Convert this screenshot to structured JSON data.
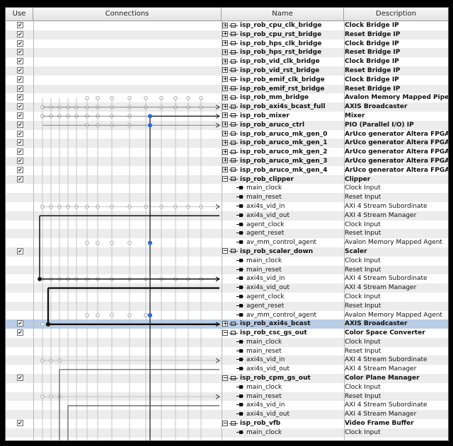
{
  "headers": {
    "use": "Use",
    "connections": "Connections",
    "name": "Name",
    "description": "Description"
  },
  "rows": [
    {
      "type": "module",
      "name": "isp_rob_cpu_clk_bridge",
      "desc": "Clock Bridge IP",
      "checked": true
    },
    {
      "type": "module",
      "name": "isp_rob_cpu_rst_bridge",
      "desc": "Reset Bridge IP",
      "checked": true
    },
    {
      "type": "module",
      "name": "isp_rob_hps_clk_bridge",
      "desc": "Clock Bridge IP",
      "checked": true
    },
    {
      "type": "module",
      "name": "isp_rob_hps_rst_bridge",
      "desc": "Reset Bridge IP",
      "checked": true
    },
    {
      "type": "module",
      "name": "isp_rob_vid_clk_bridge",
      "desc": "Clock Bridge IP",
      "checked": true
    },
    {
      "type": "module",
      "name": "isp_rob_vid_rst_bridge",
      "desc": "Reset Bridge IP",
      "checked": true
    },
    {
      "type": "module",
      "name": "isp_rob_emif_clk_bridge",
      "desc": "Clock Bridge IP",
      "checked": true
    },
    {
      "type": "module",
      "name": "isp_rob_emif_rst_bridge",
      "desc": "Reset Bridge IP",
      "checked": true
    },
    {
      "type": "module",
      "name": "isp_rob_mm_bridge",
      "desc": "Avalon Memory Mapped Pipeli...",
      "checked": true
    },
    {
      "type": "module",
      "name": "isp_rob_axi4s_bcast_full",
      "desc": "AXIS Broadcaster",
      "checked": true
    },
    {
      "type": "module",
      "name": "isp_rob_mixer",
      "desc": "Mixer",
      "checked": true
    },
    {
      "type": "module",
      "name": "isp_rob_aruco_ctrl",
      "desc": "PIO (Parallel I/O) IP",
      "checked": true
    },
    {
      "type": "module",
      "name": "isp_rob_aruco_mk_gen_0",
      "desc": "ArUco generator Altera FPGA IP",
      "checked": true
    },
    {
      "type": "module",
      "name": "isp_rob_aruco_mk_gen_1",
      "desc": "ArUco generator Altera FPGA IP",
      "checked": true
    },
    {
      "type": "module",
      "name": "isp_rob_aruco_mk_gen_2",
      "desc": "ArUco generator Altera FPGA IP",
      "checked": true
    },
    {
      "type": "module",
      "name": "isp_rob_aruco_mk_gen_3",
      "desc": "ArUco generator Altera FPGA IP",
      "checked": true
    },
    {
      "type": "module",
      "name": "isp_rob_aruco_mk_gen_4",
      "desc": "ArUco generator Altera FPGA IP",
      "checked": true
    },
    {
      "type": "module-open",
      "name": "isp_rob_clipper",
      "desc": "Clipper",
      "checked": true
    },
    {
      "type": "port",
      "name": "main_clock",
      "desc": "Clock Input"
    },
    {
      "type": "port",
      "name": "main_reset",
      "desc": "Reset Input"
    },
    {
      "type": "port",
      "name": "axi4s_vid_in",
      "desc": "AXI 4 Stream Subordinate"
    },
    {
      "type": "port",
      "name": "axi4s_vid_out",
      "desc": "AXI 4 Stream Manager"
    },
    {
      "type": "port",
      "name": "agent_clock",
      "desc": "Clock Input"
    },
    {
      "type": "port",
      "name": "agent_reset",
      "desc": "Reset Input"
    },
    {
      "type": "port",
      "name": "av_mm_control_agent",
      "desc": "Avalon Memory Mapped Agent"
    },
    {
      "type": "module-open",
      "name": "isp_rob_scaler_down",
      "desc": "Scaler",
      "checked": true
    },
    {
      "type": "port",
      "name": "main_clock",
      "desc": "Clock Input"
    },
    {
      "type": "port",
      "name": "main_reset",
      "desc": "Reset Input"
    },
    {
      "type": "port",
      "name": "axi4s_vid_in",
      "desc": "AXI 4 Stream Subordinate"
    },
    {
      "type": "port",
      "name": "axi4s_vid_out",
      "desc": "AXI 4 Stream Manager"
    },
    {
      "type": "port",
      "name": "agent_clock",
      "desc": "Clock Input"
    },
    {
      "type": "port",
      "name": "agent_reset",
      "desc": "Reset Input"
    },
    {
      "type": "port",
      "name": "av_mm_control_agent",
      "desc": "Avalon Memory Mapped Agent"
    },
    {
      "type": "module",
      "name": "isp_rob_axi4s_bcast",
      "desc": "AXIS Broadcaster",
      "checked": true,
      "selected": true
    },
    {
      "type": "module-open",
      "name": "isp_rob_csc_gs_out",
      "desc": "Color Space Converter",
      "checked": true
    },
    {
      "type": "port",
      "name": "main_clock",
      "desc": "Clock Input"
    },
    {
      "type": "port",
      "name": "main_reset",
      "desc": "Reset Input"
    },
    {
      "type": "port",
      "name": "axi4s_vid_in",
      "desc": "AXI 4 Stream Subordinate"
    },
    {
      "type": "port",
      "name": "axi4s_vid_out",
      "desc": "AXI 4 Stream Manager"
    },
    {
      "type": "module-open",
      "name": "isp_rob_cpm_gs_out",
      "desc": "Color Plane Manager",
      "checked": true
    },
    {
      "type": "port",
      "name": "main_clock",
      "desc": "Clock Input"
    },
    {
      "type": "port",
      "name": "main_reset",
      "desc": "Reset Input"
    },
    {
      "type": "port",
      "name": "axi4s_vid_in",
      "desc": "AXI 4 Stream Subordinate"
    },
    {
      "type": "port",
      "name": "axi4s_vid_out",
      "desc": "AXI 4 Stream Manager"
    },
    {
      "type": "module-open",
      "name": "isp_rob_vfb",
      "desc": "Video Frame Buffer",
      "checked": true
    },
    {
      "type": "port",
      "name": "main_clock",
      "desc": "Clock Input"
    }
  ]
}
